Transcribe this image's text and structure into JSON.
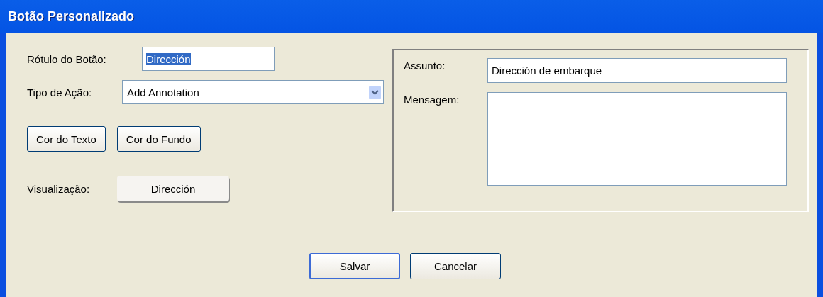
{
  "window": {
    "title": "Botão Personalizado"
  },
  "button_label": {
    "label": "Rótulo do Botão:",
    "value": "Dirección",
    "text_selected": true
  },
  "action_type": {
    "label": "Tipo de Ação:",
    "value": "Add Annotation"
  },
  "color_buttons": [
    "Cor do Texto",
    "Cor do Fundo"
  ],
  "preview": {
    "label": "Visualização:",
    "button": "Dirección"
  },
  "subject": {
    "label": "Assunto:",
    "value": "Dirección de embarque"
  },
  "message": {
    "label": "Mensagem:"
  },
  "buttons": [
    {
      "label": "Salvar",
      "default": true,
      "mnemonic": true
    },
    {
      "label": "Cancelar",
      "default": false,
      "mnemonic": false
    }
  ]
}
